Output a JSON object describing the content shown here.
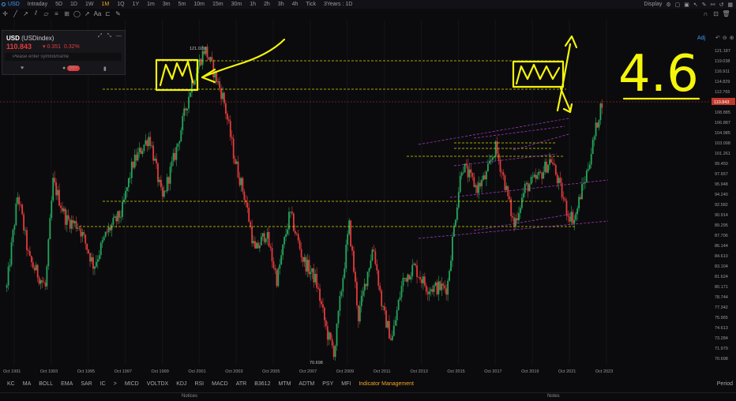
{
  "toolbar": {
    "symbol": "USD",
    "periods": [
      "Intraday",
      "5D",
      "1D",
      "1W",
      "1M",
      "1Q",
      "1Y",
      "1m",
      "3m",
      "5m",
      "10m",
      "15m",
      "30m",
      "1h",
      "2h",
      "3h",
      "4h",
      "Tick",
      "3Years : 1D"
    ],
    "active_period": "1M",
    "display_label": "Display"
  },
  "quote": {
    "symbol": "USD",
    "name": "(USDindex)",
    "price": "110.843",
    "change": "0.351",
    "change_pct": "0.32%",
    "search_placeholder": "Please enter symbol/name",
    "badge": "99+"
  },
  "chart": {
    "adj_label": "Adj",
    "high_label": "121.020",
    "low_label": "70.698",
    "current_price_label": "110.843",
    "hand_annotation": "4.6",
    "y_ticks": [
      "121.187",
      "119.038",
      "116.911",
      "114.829",
      "112.765",
      "110.843",
      "108.885",
      "106.887",
      "104.985",
      "103.098",
      "101.261",
      "99.450",
      "97.657",
      "95.948",
      "94.240",
      "92.582",
      "90.914",
      "89.295",
      "87.706",
      "86.144",
      "84.610",
      "83.104",
      "81.624",
      "80.171",
      "78.744",
      "77.342",
      "75.965",
      "74.613",
      "73.284",
      "71.979",
      "70.698"
    ],
    "x_ticks": [
      "Oct 1991",
      "Oct 1993",
      "Oct 1995",
      "Oct 1997",
      "Oct 1999",
      "Oct 2001",
      "Oct 2003",
      "Oct 2005",
      "Oct 2007",
      "Oct 2009",
      "Oct 2011",
      "Oct 2013",
      "Oct 2015",
      "Oct 2017",
      "Oct 2019",
      "Oct 2021",
      "Oct 2023"
    ],
    "colors": {
      "up": "#26a65b",
      "down": "#e23b3b",
      "level": "#d6d600",
      "channel": "#b43cc8",
      "annotation": "#f5f50a",
      "current": "#c0392b"
    }
  },
  "indicators": [
    "KC",
    "MA",
    "BOLL",
    "EMA",
    "SAR",
    "IC",
    ">",
    "MICD",
    "VOLTDX",
    "KDJ",
    "RSI",
    "MACD",
    "ATR",
    "B3612",
    "MTM",
    "ADTM",
    "PSY",
    "MFI",
    "Indicator Management"
  ],
  "period_label": "Period",
  "footer": {
    "notices_left": "Notices",
    "notices_right": "Notes"
  }
}
